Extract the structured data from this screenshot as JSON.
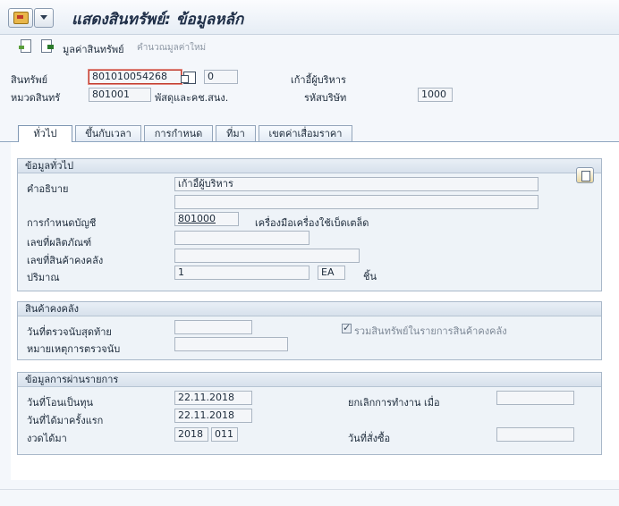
{
  "window": {
    "title": "แสดงสินทรัพย์:  ข้อมูลหลัก"
  },
  "toolbar": {
    "asset_values": "มูลค่าสินทรัพย์",
    "recalculate": "คำนวณมูลค่าใหม่"
  },
  "header": {
    "asset_label": "สินทรัพย์",
    "asset_number": "801010054268",
    "sub_number": "0",
    "asset_description": "เก้าอี้ผู้บริหาร",
    "class_label": "หมวดสินทรั",
    "class_value": "801001",
    "class_description": "พัสดุและคช.สนง.",
    "company_label": "รหัสบริษัท",
    "company_value": "1000"
  },
  "tabs": [
    {
      "label": "ทั่วไป",
      "active": true
    },
    {
      "label": "ขึ้นกับเวลา",
      "active": false
    },
    {
      "label": "การกำหนด",
      "active": false
    },
    {
      "label": "ที่มา",
      "active": false
    },
    {
      "label": "เขตค่าเสื่อมราคา",
      "active": false
    }
  ],
  "general": {
    "title": "ข้อมูลทั่วไป",
    "description_label": "คำอธิบาย",
    "description_1": "เก้าอี้ผู้บริหาร",
    "description_2": "",
    "account_label": "การกำหนดบัญชี",
    "account_value": "801000",
    "account_text": "เครื่องมือเครื่องใช้เบ็ดเตล็ด",
    "serial_label": "เลขที่ผลิตภัณฑ์",
    "serial_value": "",
    "inventory_label": "เลขที่สินค้าคงคลัง",
    "inventory_value": "",
    "quantity_label": "ปริมาณ",
    "quantity_value": "1",
    "unit_value": "EA",
    "unit_text": "ชิ้น"
  },
  "inventory": {
    "title": "สินค้าคงคลัง",
    "last_count_label": "วันที่ตรวจนับสุดท้าย",
    "last_count_value": "",
    "include_label": "รวมสินทรัพย์ในรายการสินค้าคงคลัง",
    "include_checked": true,
    "note_label": "หมายเหตุการตรวจนับ",
    "note_value": ""
  },
  "posting": {
    "title": "ข้อมูลการผ่านรายการ",
    "capitalized_label": "วันที่โอนเป็นทุน",
    "capitalized_value": "22.11.2018",
    "deactivation_label": "ยกเลิกการทำงาน เมื่อ",
    "deactivation_value": "",
    "first_acq_label": "วันที่ได้มาครั้งแรก",
    "first_acq_value": "22.11.2018",
    "period_label": "งวดได้มา",
    "period_year": "2018",
    "period_num": "011",
    "order_label": "วันที่สั่งซื้อ",
    "order_value": ""
  }
}
